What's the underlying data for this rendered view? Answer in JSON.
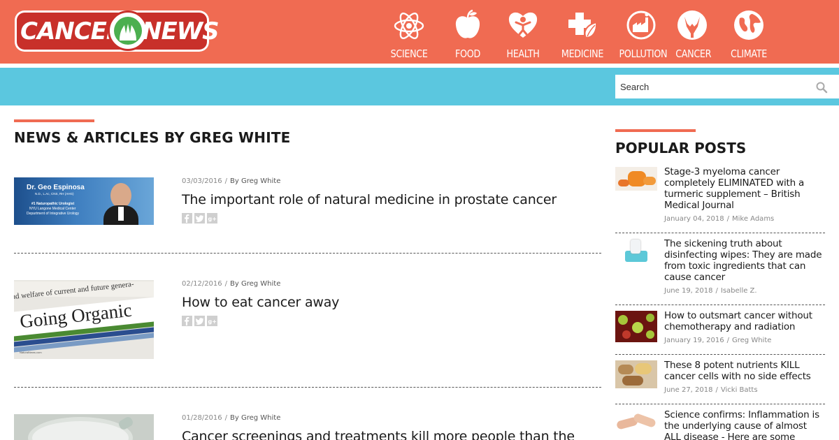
{
  "brand": {
    "left": "CANCER",
    "right": "NEWS"
  },
  "nav": [
    {
      "label": "SCIENCE",
      "icon": "atom-icon"
    },
    {
      "label": "FOOD",
      "icon": "apple-icon"
    },
    {
      "label": "HEALTH",
      "icon": "heart-person-icon"
    },
    {
      "label": "MEDICINE",
      "icon": "medical-cross-leaf-icon"
    },
    {
      "label": "POLLUTION",
      "icon": "factory-icon"
    },
    {
      "label": "CANCER",
      "icon": "hands-icon"
    },
    {
      "label": "CLIMATE",
      "icon": "globe-icon"
    }
  ],
  "search": {
    "placeholder": "Search"
  },
  "page": {
    "title": "NEWS & ARTICLES BY GREG WHITE"
  },
  "articles": [
    {
      "date": "03/03/2016",
      "author": "By Greg White",
      "title": "The important role of natural medicine in prostate cancer",
      "thumb": {
        "name": "Dr. Geo Espinosa",
        "credentials": "N.D., L.Ac, CNS, RH (AHG)",
        "line1": "#1 Naturopathic Urologist",
        "line2": "NYU Langone Medical Center",
        "line3": "Department of Integrative Urology"
      }
    },
    {
      "date": "02/12/2016",
      "author": "By Greg White",
      "title": "How to eat cancer away",
      "thumb": {
        "headline": "Going Organic",
        "topline": "nd welfare of current and future genera-",
        "credit": "NaturalNews.com"
      }
    },
    {
      "date": "01/28/2016",
      "author": "By Greg White",
      "title": "Cancer screenings and treatments kill more people than the"
    }
  ],
  "share_icons": [
    "facebook-icon",
    "twitter-icon",
    "google-plus-icon"
  ],
  "popular": {
    "title": "POPULAR POSTS",
    "items": [
      {
        "title": "Stage-3 myeloma cancer completely ELIMINATED with a turmeric supplement – British Medical Journal",
        "date": "January 04, 2018",
        "author": "Mike Adams"
      },
      {
        "title": "The sickening truth about disinfecting wipes: They are made from toxic ingredients that can cause cancer",
        "date": "June 19, 2018",
        "author": "Isabelle Z."
      },
      {
        "title": "How to outsmart cancer without chemotherapy and radiation",
        "date": "January 19, 2016",
        "author": "Greg White"
      },
      {
        "title": "These 8 potent nutrients KILL cancer cells with no side effects",
        "date": "June 27, 2018",
        "author": "Vicki Batts"
      },
      {
        "title": "Science confirms: Inflammation is the underlying cause of almost ALL disease - Here are some natural",
        "date": "",
        "author": ""
      }
    ]
  },
  "colors": {
    "header": "#f06b52",
    "bar": "#5bc7df",
    "accent": "#f06b52"
  }
}
